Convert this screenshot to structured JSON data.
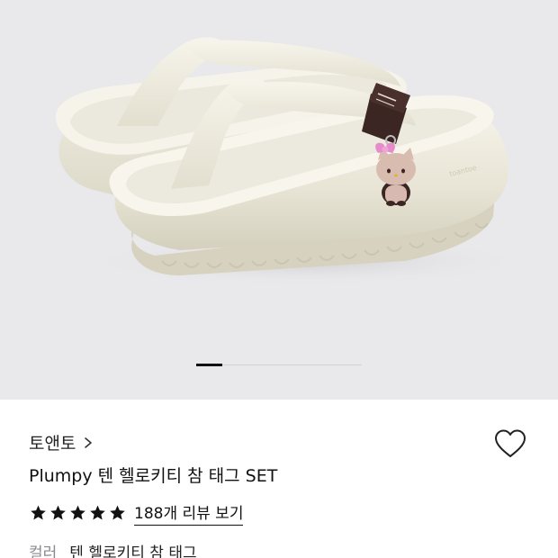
{
  "gallery": {
    "image_alt": "Plumpy 텐 헬로키티 참 태그 SET",
    "pager_position": 1,
    "pager_fraction": 0.16
  },
  "product": {
    "brand": "토앤토",
    "title": "Plumpy 텐 헬로키티 참 태그 SET",
    "rating": 5,
    "review_link": "188개 리뷰 보기",
    "option_label": "컬러",
    "option_value": "텐 헬로키티 참 태그"
  },
  "icons": {
    "brand_chevron": "chevron-right-icon",
    "wishlist": "heart-outline-icon",
    "star": "star-filled-icon"
  },
  "colors": {
    "gallery_bg": "#e9e9eb",
    "sandal": "#f1efe3",
    "charm_tag": "#3b2623",
    "bow": "#e78ccb",
    "text_primary": "#111111",
    "text_muted": "#8a8a8e"
  }
}
